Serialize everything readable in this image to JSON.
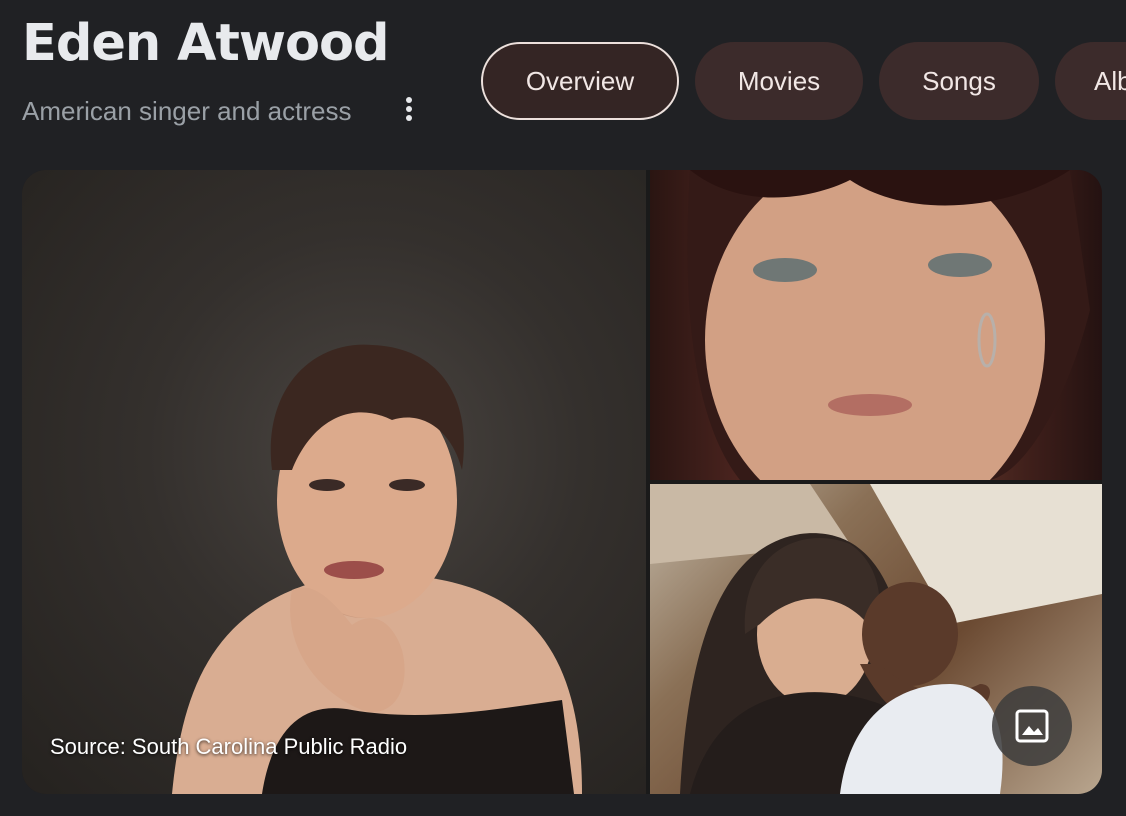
{
  "entity": {
    "title": "Eden Atwood",
    "subtitle": "American singer and actress"
  },
  "icons": {
    "more": "more-vert-icon",
    "image": "image-icon"
  },
  "tabs": [
    {
      "label": "Overview",
      "active": true
    },
    {
      "label": "Movies",
      "active": false
    },
    {
      "label": "Songs",
      "active": false
    },
    {
      "label": "Alb",
      "active": false
    }
  ],
  "gallery": {
    "source_text": "Source: South Carolina Public Radio"
  },
  "colors": {
    "background": "#202124",
    "chip": "#3c2b2b",
    "chip_active_border": "#ece0dc",
    "subtitle": "#9aa0a6"
  }
}
